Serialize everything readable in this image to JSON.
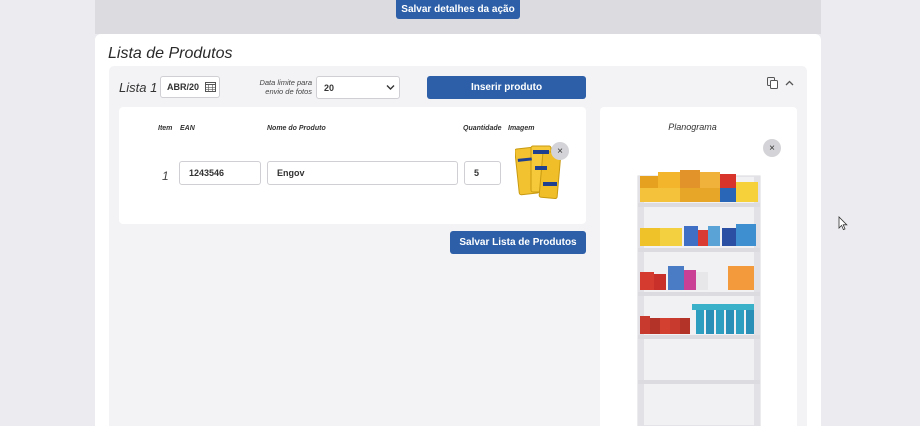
{
  "header": {
    "save_action_label": "Salvar detalhes da ação"
  },
  "panel": {
    "title": "Lista de Produtos"
  },
  "list": {
    "label": "Lista 1",
    "month": "ABR/20",
    "date_limit_label_1": "Data limite para",
    "date_limit_label_2": "envio de fotos",
    "date_limit_value": "20",
    "insert_label": "Inserir produto"
  },
  "table": {
    "headers": {
      "item": "Item",
      "ean": "EAN",
      "name": "Nome do Produto",
      "qty": "Quantidade",
      "image": "Imagem"
    },
    "rows": [
      {
        "item": "1",
        "ean": "1243546",
        "name": "Engov",
        "qty": "5"
      }
    ]
  },
  "save_list_label": "Salvar Lista de Produtos",
  "planogram": {
    "title": "Planograma"
  },
  "icons": {
    "remove": "×"
  },
  "colors": {
    "primary": "#2c5fa8"
  }
}
